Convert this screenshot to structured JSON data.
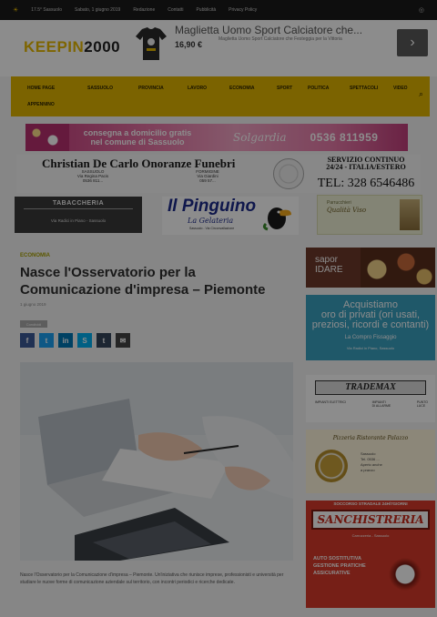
{
  "topbar": {
    "weather": "17.5° Sassuolo",
    "links": [
      "Sabato, 1 giugno 2019",
      "Redazione",
      "Contatti",
      "Pubblicità",
      "Privacy Policy"
    ]
  },
  "header": {
    "logo_a": "KEEPIN",
    "logo_b": "2000",
    "promo_title": "Maglietta Uomo Sport Calciatore che...",
    "promo_price": "16,90 €",
    "promo_desc": "Maglietta Uomo Sport Calciatore che Festeggia per la Vittoria",
    "promo_next": "›"
  },
  "nav": {
    "items": [
      "Home Page",
      "Sassuolo",
      "Provincia",
      "Lavoro",
      "Economia",
      "Sport",
      "Politica",
      "Spettacoli",
      "Video"
    ],
    "row2": "Appennino",
    "search_icon": "⌕"
  },
  "ads": {
    "flowers": {
      "line1": "consegna a domicilio gratis",
      "line2": "nel comune di Sassuolo",
      "brand": "Solgardia",
      "phone": "0536 811959"
    },
    "funeral": {
      "name": "Christian De Carlo Onoranze Funebri",
      "city1": "SASSUOLO\nVia Regina Pacis\n0536 811...",
      "city2": "FORMIGINE\nVia Giardini\n059 57...",
      "service": "SERVIZIO CONTINUO\n24/24 - ITALIA/ESTERO",
      "tel": "TEL: 328 6546486"
    },
    "tabaccheria": {
      "title": "TABACCHERIA",
      "sub": "Via Radici in Piano - Sassuolo"
    },
    "pinguino": {
      "title": "Il Pinguino",
      "sub": "La Gelateria",
      "sub2": "Sassuolo - Via Circonvallazione"
    },
    "qualita": {
      "line1": "Parrucchieri",
      "line2": "Qualità Viso"
    }
  },
  "article": {
    "category": "Economia",
    "title": "Nasce l'Osservatorio per la Comunicazione d'impresa – Piemonte",
    "byline": "1 giugno 2019",
    "share_label": "Condividi",
    "share_buttons": [
      {
        "icon": "facebook-icon",
        "glyph": "f",
        "color": "#3b5998"
      },
      {
        "icon": "twitter-icon",
        "glyph": "t",
        "color": "#1da1f2"
      },
      {
        "icon": "linkedin-icon",
        "glyph": "in",
        "color": "#0077b5"
      },
      {
        "icon": "skype-icon",
        "glyph": "S",
        "color": "#00aff0"
      },
      {
        "icon": "tumblr-icon",
        "glyph": "t",
        "color": "#35465c"
      },
      {
        "icon": "email-icon",
        "glyph": "✉",
        "color": "#444444"
      }
    ],
    "body": "Nasce l'Osservatorio per la Comunicazione d'impresa – Piemonte. Un'iniziativa che riunisce imprese, professionisti e università per studiare le nuove forme di comunicazione aziendale sul territorio, con incontri periodici e ricerche dedicate."
  },
  "sidebar": {
    "sapori": "sapor\nIDARE",
    "acquistiamo": {
      "title": "Acquistiamo\noro di privati (ori usati,\npreziosi, ricordi e contanti)",
      "brand": "La Compro Fissaggio",
      "note": "Via Radici in Piano, Sassuolo"
    },
    "gruppo": {
      "logo": "TRADEMAX",
      "cols": [
        "IMPIANTI ELETTRICI",
        "IMPIANTI\nDI ALLARME",
        "PUNTO\nLUCE"
      ]
    },
    "pizzeria": {
      "title": "Pizzeria Ristorante Palazzo",
      "info": "Sassuolo\nTel. 0536 ...\nAperto anche\na pranzo"
    },
    "carrozzeria": {
      "header": "SOCCORSO STRADALE 24H/7GIORNI",
      "name": "SANCHISTRERIA",
      "sub": "Carrozzeria - Sassuolo",
      "lines": [
        "AUTO SOSTITUTIVA",
        "GESTIONE PRATICHE",
        "ASSICURATIVE"
      ]
    }
  },
  "colors": {
    "accent": "#e0b400",
    "header_bg": "#ffffff",
    "topbar_bg": "#1a1a1a",
    "dim_overlay": "rgba(0,0,0,0.45)"
  }
}
